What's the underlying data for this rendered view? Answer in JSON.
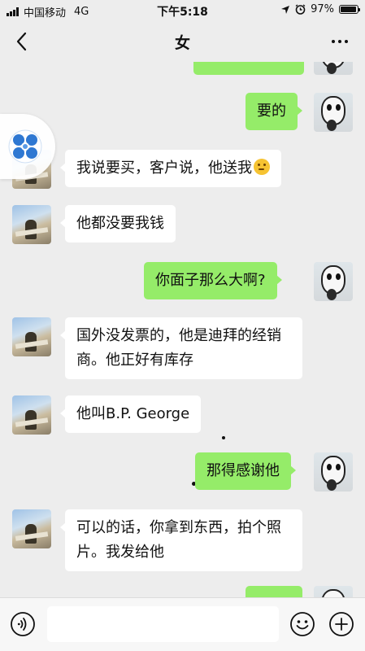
{
  "status_bar": {
    "carrier": "中国移动",
    "network": "4G",
    "time": "下午5:18",
    "battery": "97%",
    "battery_level": 0.97
  },
  "navbar": {
    "title": "女"
  },
  "messages": [
    {
      "side": "out",
      "text": "",
      "truncated": true
    },
    {
      "side": "out",
      "text": "要的"
    },
    {
      "side": "in",
      "text": "我说要买，客户说，他送我",
      "emoji": "thinking-face-emoji"
    },
    {
      "side": "in",
      "text": "他都没要我钱"
    },
    {
      "side": "out",
      "text": "你面子那么大啊?"
    },
    {
      "side": "in",
      "text": "国外没发票的，他是迪拜的经销商。他正好有库存"
    },
    {
      "side": "in",
      "text": "他叫B.P. George"
    },
    {
      "side": "out",
      "text": "那得感谢他"
    },
    {
      "side": "in",
      "text": "可以的话，你拿到东西，拍个照片。我发给他"
    },
    {
      "side": "out",
      "text": "",
      "truncated": true
    }
  ],
  "icons": {
    "back": "back-chevron-icon",
    "more": "more-dots-icon",
    "voice": "voice-input-icon",
    "emoji": "emoji-icon",
    "plus": "plus-icon",
    "float": "floating-assistant-icon"
  },
  "colors": {
    "background": "#ededed",
    "bubble_out": "#95ec69",
    "bubble_in": "#ffffff",
    "float_icon": "#2f78d2"
  },
  "input": {
    "value": "",
    "placeholder": ""
  }
}
